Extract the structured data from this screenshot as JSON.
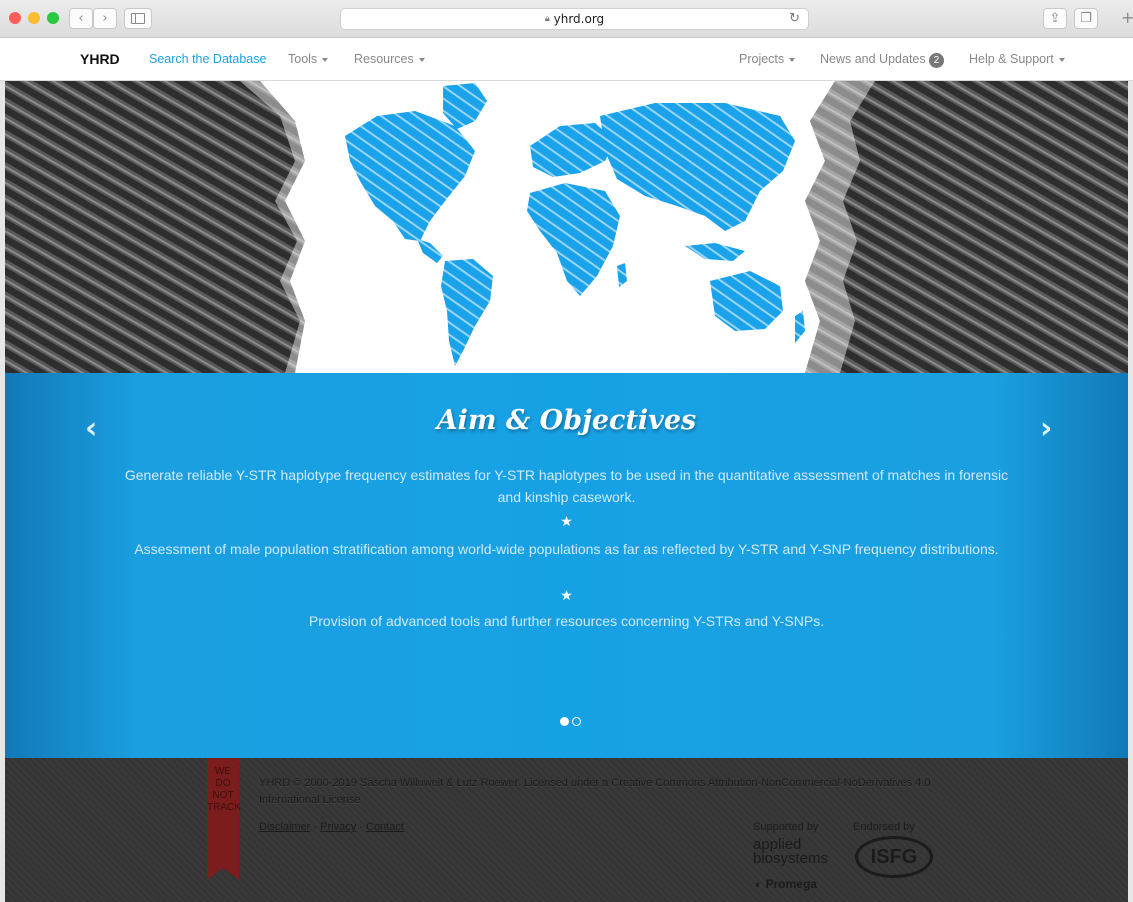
{
  "browser": {
    "url": "yhrd.org",
    "lock_icon": "lock-icon",
    "colors": {
      "close": "#ff5f57",
      "minimize": "#febc2e",
      "zoom": "#28c840"
    }
  },
  "navbar": {
    "brand": "YHRD",
    "left_items": [
      {
        "label": "Search the Database",
        "active": true
      },
      {
        "label": "Tools",
        "dropdown": true
      },
      {
        "label": "Resources",
        "dropdown": true
      }
    ],
    "right_items": [
      {
        "label": "Projects",
        "dropdown": true
      },
      {
        "label": "News and Updates",
        "badge": "2"
      },
      {
        "label": "Help & Support",
        "dropdown": true
      }
    ],
    "accent_color": "#1ea0df"
  },
  "carousel": {
    "title": "Aim & Objectives",
    "paragraphs": [
      "Generate reliable Y-STR haplotype frequency estimates for Y-STR haplotypes to be used in the quantitative assessment of matches in forensic and kinship casework.",
      "Assessment of male population stratification among world-wide populations as far as reflected by Y-STR and Y-SNP frequency distributions.",
      "Provision of advanced tools and further resources concerning Y-STRs and Y-SNPs."
    ],
    "separator": "★",
    "prev_icon": "‹",
    "next_icon": "›",
    "slide_count": 2,
    "active_slide": 1,
    "background_color": "#17a1e5"
  },
  "footer": {
    "ribbon": [
      "WE",
      "DO",
      "NOT",
      "TRACK"
    ],
    "license": "YHRD © 2000-2019 Sascha Willuweit & Lutz Roewer. Licensed under a Creative Commons Attribution-NonCommercial-NoDerivatives 4.0 International License",
    "links": [
      "Disclaimer",
      "Privacy",
      "Contact"
    ],
    "link_separator": "·",
    "supported_by": "Supported by",
    "endorsed_by": "Endorsed by",
    "sponsor_1_line_1": "applied",
    "sponsor_1_line_2": "biosystems",
    "sponsor_2": "Promega",
    "endorser": "ISFG"
  }
}
